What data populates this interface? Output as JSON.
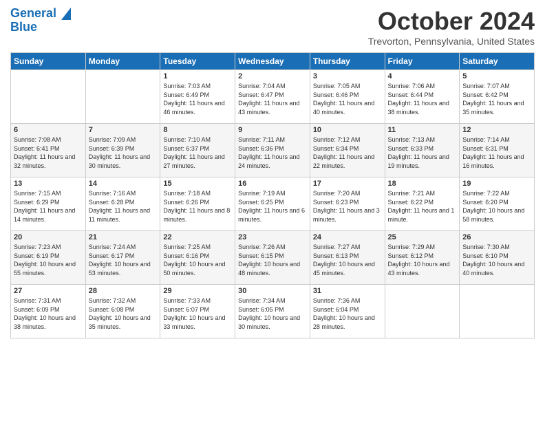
{
  "logo": {
    "line1": "General",
    "line2": "Blue"
  },
  "title": "October 2024",
  "location": "Trevorton, Pennsylvania, United States",
  "headers": [
    "Sunday",
    "Monday",
    "Tuesday",
    "Wednesday",
    "Thursday",
    "Friday",
    "Saturday"
  ],
  "weeks": [
    [
      {
        "day": "",
        "sunrise": "",
        "sunset": "",
        "daylight": ""
      },
      {
        "day": "",
        "sunrise": "",
        "sunset": "",
        "daylight": ""
      },
      {
        "day": "1",
        "sunrise": "Sunrise: 7:03 AM",
        "sunset": "Sunset: 6:49 PM",
        "daylight": "Daylight: 11 hours and 46 minutes."
      },
      {
        "day": "2",
        "sunrise": "Sunrise: 7:04 AM",
        "sunset": "Sunset: 6:47 PM",
        "daylight": "Daylight: 11 hours and 43 minutes."
      },
      {
        "day": "3",
        "sunrise": "Sunrise: 7:05 AM",
        "sunset": "Sunset: 6:46 PM",
        "daylight": "Daylight: 11 hours and 40 minutes."
      },
      {
        "day": "4",
        "sunrise": "Sunrise: 7:06 AM",
        "sunset": "Sunset: 6:44 PM",
        "daylight": "Daylight: 11 hours and 38 minutes."
      },
      {
        "day": "5",
        "sunrise": "Sunrise: 7:07 AM",
        "sunset": "Sunset: 6:42 PM",
        "daylight": "Daylight: 11 hours and 35 minutes."
      }
    ],
    [
      {
        "day": "6",
        "sunrise": "Sunrise: 7:08 AM",
        "sunset": "Sunset: 6:41 PM",
        "daylight": "Daylight: 11 hours and 32 minutes."
      },
      {
        "day": "7",
        "sunrise": "Sunrise: 7:09 AM",
        "sunset": "Sunset: 6:39 PM",
        "daylight": "Daylight: 11 hours and 30 minutes."
      },
      {
        "day": "8",
        "sunrise": "Sunrise: 7:10 AM",
        "sunset": "Sunset: 6:37 PM",
        "daylight": "Daylight: 11 hours and 27 minutes."
      },
      {
        "day": "9",
        "sunrise": "Sunrise: 7:11 AM",
        "sunset": "Sunset: 6:36 PM",
        "daylight": "Daylight: 11 hours and 24 minutes."
      },
      {
        "day": "10",
        "sunrise": "Sunrise: 7:12 AM",
        "sunset": "Sunset: 6:34 PM",
        "daylight": "Daylight: 11 hours and 22 minutes."
      },
      {
        "day": "11",
        "sunrise": "Sunrise: 7:13 AM",
        "sunset": "Sunset: 6:33 PM",
        "daylight": "Daylight: 11 hours and 19 minutes."
      },
      {
        "day": "12",
        "sunrise": "Sunrise: 7:14 AM",
        "sunset": "Sunset: 6:31 PM",
        "daylight": "Daylight: 11 hours and 16 minutes."
      }
    ],
    [
      {
        "day": "13",
        "sunrise": "Sunrise: 7:15 AM",
        "sunset": "Sunset: 6:29 PM",
        "daylight": "Daylight: 11 hours and 14 minutes."
      },
      {
        "day": "14",
        "sunrise": "Sunrise: 7:16 AM",
        "sunset": "Sunset: 6:28 PM",
        "daylight": "Daylight: 11 hours and 11 minutes."
      },
      {
        "day": "15",
        "sunrise": "Sunrise: 7:18 AM",
        "sunset": "Sunset: 6:26 PM",
        "daylight": "Daylight: 11 hours and 8 minutes."
      },
      {
        "day": "16",
        "sunrise": "Sunrise: 7:19 AM",
        "sunset": "Sunset: 6:25 PM",
        "daylight": "Daylight: 11 hours and 6 minutes."
      },
      {
        "day": "17",
        "sunrise": "Sunrise: 7:20 AM",
        "sunset": "Sunset: 6:23 PM",
        "daylight": "Daylight: 11 hours and 3 minutes."
      },
      {
        "day": "18",
        "sunrise": "Sunrise: 7:21 AM",
        "sunset": "Sunset: 6:22 PM",
        "daylight": "Daylight: 11 hours and 1 minute."
      },
      {
        "day": "19",
        "sunrise": "Sunrise: 7:22 AM",
        "sunset": "Sunset: 6:20 PM",
        "daylight": "Daylight: 10 hours and 58 minutes."
      }
    ],
    [
      {
        "day": "20",
        "sunrise": "Sunrise: 7:23 AM",
        "sunset": "Sunset: 6:19 PM",
        "daylight": "Daylight: 10 hours and 55 minutes."
      },
      {
        "day": "21",
        "sunrise": "Sunrise: 7:24 AM",
        "sunset": "Sunset: 6:17 PM",
        "daylight": "Daylight: 10 hours and 53 minutes."
      },
      {
        "day": "22",
        "sunrise": "Sunrise: 7:25 AM",
        "sunset": "Sunset: 6:16 PM",
        "daylight": "Daylight: 10 hours and 50 minutes."
      },
      {
        "day": "23",
        "sunrise": "Sunrise: 7:26 AM",
        "sunset": "Sunset: 6:15 PM",
        "daylight": "Daylight: 10 hours and 48 minutes."
      },
      {
        "day": "24",
        "sunrise": "Sunrise: 7:27 AM",
        "sunset": "Sunset: 6:13 PM",
        "daylight": "Daylight: 10 hours and 45 minutes."
      },
      {
        "day": "25",
        "sunrise": "Sunrise: 7:29 AM",
        "sunset": "Sunset: 6:12 PM",
        "daylight": "Daylight: 10 hours and 43 minutes."
      },
      {
        "day": "26",
        "sunrise": "Sunrise: 7:30 AM",
        "sunset": "Sunset: 6:10 PM",
        "daylight": "Daylight: 10 hours and 40 minutes."
      }
    ],
    [
      {
        "day": "27",
        "sunrise": "Sunrise: 7:31 AM",
        "sunset": "Sunset: 6:09 PM",
        "daylight": "Daylight: 10 hours and 38 minutes."
      },
      {
        "day": "28",
        "sunrise": "Sunrise: 7:32 AM",
        "sunset": "Sunset: 6:08 PM",
        "daylight": "Daylight: 10 hours and 35 minutes."
      },
      {
        "day": "29",
        "sunrise": "Sunrise: 7:33 AM",
        "sunset": "Sunset: 6:07 PM",
        "daylight": "Daylight: 10 hours and 33 minutes."
      },
      {
        "day": "30",
        "sunrise": "Sunrise: 7:34 AM",
        "sunset": "Sunset: 6:05 PM",
        "daylight": "Daylight: 10 hours and 30 minutes."
      },
      {
        "day": "31",
        "sunrise": "Sunrise: 7:36 AM",
        "sunset": "Sunset: 6:04 PM",
        "daylight": "Daylight: 10 hours and 28 minutes."
      },
      {
        "day": "",
        "sunrise": "",
        "sunset": "",
        "daylight": ""
      },
      {
        "day": "",
        "sunrise": "",
        "sunset": "",
        "daylight": ""
      }
    ]
  ]
}
